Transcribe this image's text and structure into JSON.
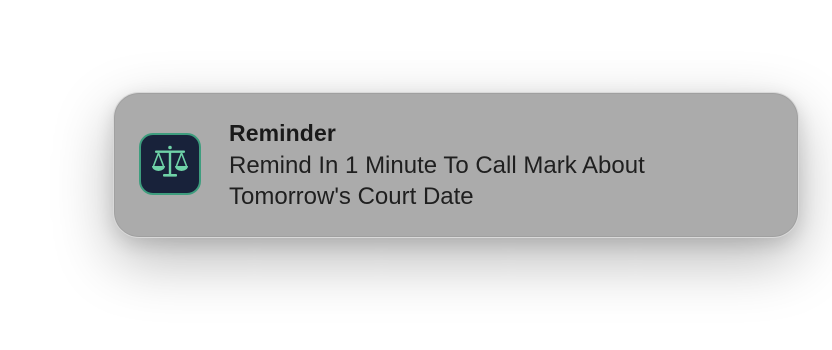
{
  "notification": {
    "app_icon": "scales-of-justice-icon",
    "title": "Reminder",
    "body": "Remind In 1 Minute To Call Mark About Tomorrow's Court Date"
  },
  "colors": {
    "notification_background": "#ababab",
    "icon_background": "#18223a",
    "icon_accent": "#6fd3a8",
    "text": "#1a1a1a"
  }
}
